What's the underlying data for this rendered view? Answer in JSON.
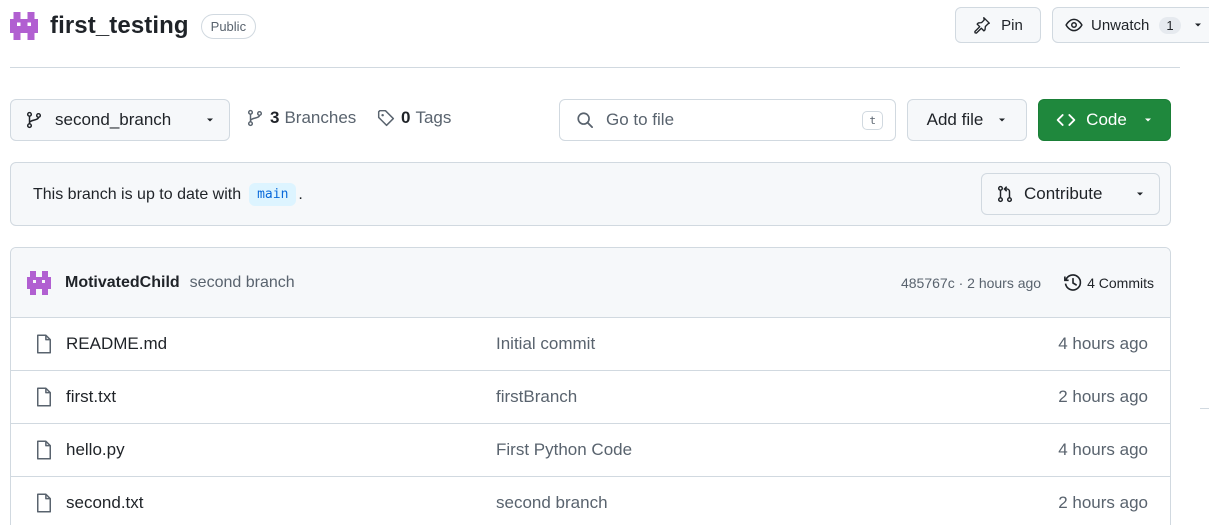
{
  "repo": {
    "name": "first_testing",
    "visibility": "Public"
  },
  "actions": {
    "pin_label": "Pin",
    "unwatch_label": "Unwatch",
    "watch_count": "1"
  },
  "toolbar": {
    "branch": "second_branch",
    "branches_count": "3",
    "branches_label": "Branches",
    "tags_count": "0",
    "tags_label": "Tags",
    "goto_placeholder": "Go to file",
    "goto_shortcut": "t",
    "add_file_label": "Add file",
    "code_label": "Code"
  },
  "status": {
    "prefix": "This branch is up to date with",
    "base_branch": "main",
    "suffix": ".",
    "contribute_label": "Contribute"
  },
  "latest_commit": {
    "author": "MotivatedChild",
    "message": "second branch",
    "meta": "485767c · 2 hours ago",
    "commits_label": "4 Commits"
  },
  "files": [
    {
      "name": "README.md",
      "message": "Initial commit",
      "time": "4 hours ago"
    },
    {
      "name": "first.txt",
      "message": "firstBranch",
      "time": "2 hours ago"
    },
    {
      "name": "hello.py",
      "message": "First Python Code",
      "time": "4 hours ago"
    },
    {
      "name": "second.txt",
      "message": "second branch",
      "time": "2 hours ago"
    }
  ],
  "colors": {
    "accent_green": "#1f883d",
    "avatar_purple": "#a855c7",
    "link_blue": "#0969da"
  }
}
